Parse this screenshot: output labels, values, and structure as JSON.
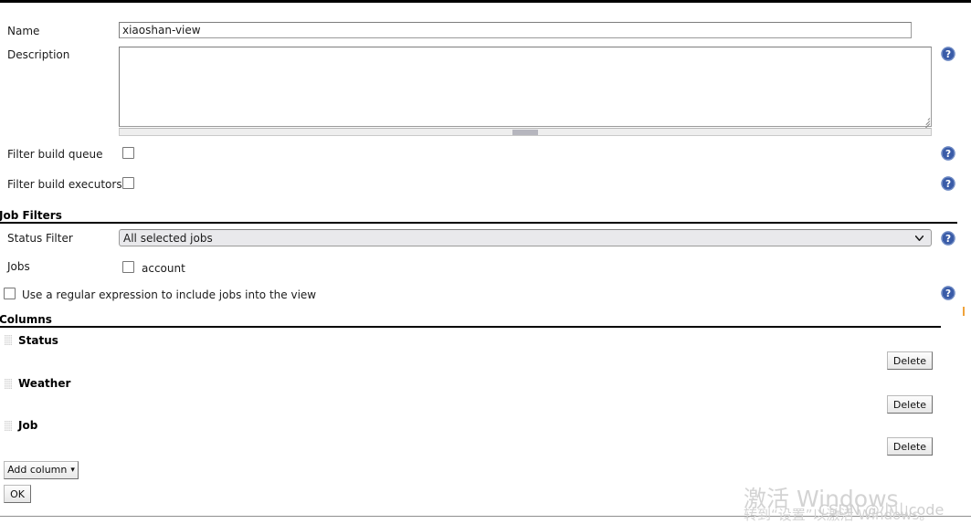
{
  "form": {
    "name": {
      "label": "Name",
      "value": "xiaoshan-view",
      "placeholder": ""
    },
    "description": {
      "label": "Description",
      "value": "",
      "placeholder": ""
    },
    "filter_build_queue": {
      "label": "Filter build queue",
      "checked": false
    },
    "filter_build_executors": {
      "label": "Filter build executors",
      "checked": false
    }
  },
  "job_filters": {
    "section_title": "Job Filters",
    "status_filter": {
      "label": "Status Filter",
      "selected": "All selected jobs",
      "options": [
        "All selected jobs"
      ]
    },
    "jobs": {
      "label": "Jobs",
      "items": [
        {
          "label": "account",
          "checked": false
        }
      ]
    },
    "use_regex": {
      "label": "Use a regular expression to include jobs into the view",
      "checked": false
    }
  },
  "columns": {
    "section_title": "Columns",
    "items": [
      {
        "name": "Status",
        "delete_label": "Delete"
      },
      {
        "name": "Weather",
        "delete_label": "Delete"
      },
      {
        "name": "Job",
        "delete_label": "Delete"
      }
    ],
    "add_column_label": "Add column",
    "add_column_caret": "▾"
  },
  "actions": {
    "ok_label": "OK"
  },
  "icons": {
    "help": "help-icon",
    "chevron_down": "chevron-down-icon",
    "drag_handle": "drag-handle-icon"
  },
  "watermark": {
    "windows_title": "激活 Windows",
    "windows_sub": "转到“设置”以激活 Windows。",
    "csdn": "CSDN @小山code"
  },
  "colors": {
    "help_blue": "#3a5ca8",
    "section_rule": "#000000",
    "select_bg": "#e9e9ec"
  }
}
